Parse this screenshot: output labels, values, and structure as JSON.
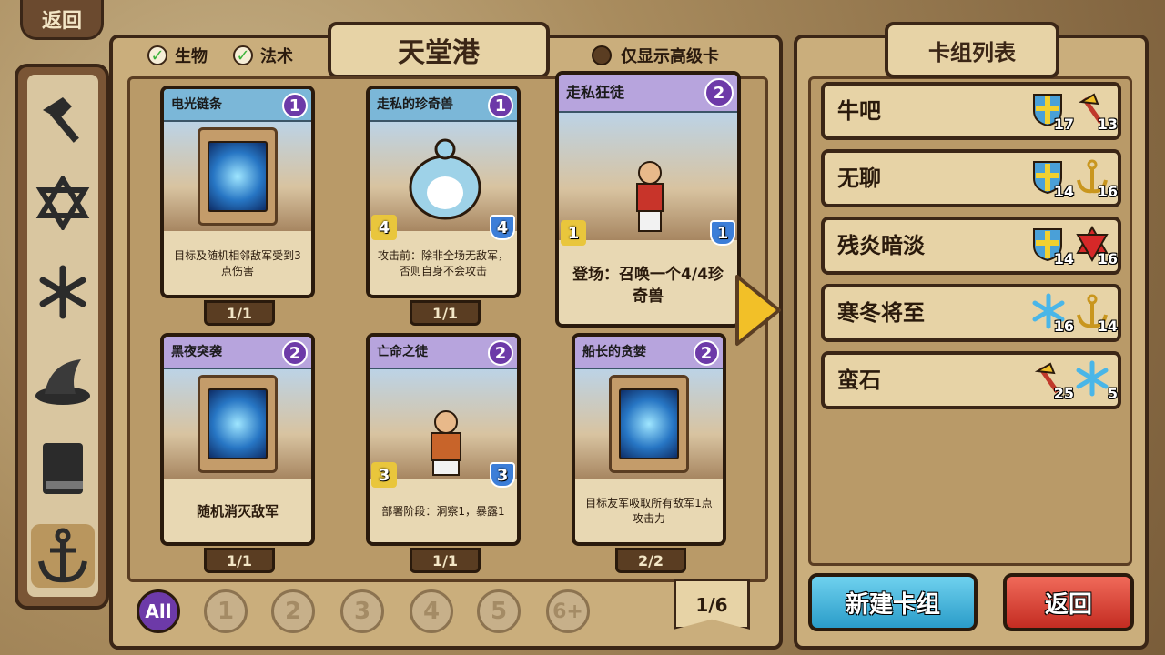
{
  "top_back_label": "返回",
  "filters": {
    "creature_label": "生物",
    "spell_label": "法术",
    "advanced_only_label": "仅显示高级卡"
  },
  "card_panel_title": "天堂港",
  "cards": [
    {
      "name": "电光链条",
      "cost": "1",
      "text": "目标及随机相邻敌军受到3点伤害",
      "count": "1/1"
    },
    {
      "name": "走私的珍奇兽",
      "cost": "1",
      "attack": "4",
      "health": "4",
      "text": "攻击前：除非全场无敌军，否则自身不会攻击",
      "count": "1/1"
    },
    {
      "name": "走私狂徒",
      "cost": "2",
      "attack": "1",
      "health": "1",
      "text": "登场：召唤一个4/4珍奇兽"
    },
    {
      "name": "黑夜突袭",
      "cost": "2",
      "text": "随机消灭敌军",
      "count": "1/1"
    },
    {
      "name": "亡命之徒",
      "cost": "2",
      "attack": "3",
      "health": "3",
      "text": "部署阶段：洞察1，暴露1",
      "count": "1/1"
    },
    {
      "name": "船长的贪婪",
      "cost": "2",
      "text": "目标友军吸取所有敌军1点攻击力",
      "count": "2/2"
    }
  ],
  "cost_filters": [
    "All",
    "1",
    "2",
    "3",
    "4",
    "5",
    "6+"
  ],
  "page_indicator": "1/6",
  "deck_panel_title": "卡组列表",
  "decks": [
    {
      "name": "牛吧",
      "stat1": "17",
      "stat2": "13",
      "icon1": "shield-icon",
      "icon2": "axe-icon"
    },
    {
      "name": "无聊",
      "stat1": "14",
      "stat2": "16",
      "icon1": "shield-icon",
      "icon2": "anchor-icon"
    },
    {
      "name": "残炎暗淡",
      "stat1": "14",
      "stat2": "16",
      "icon1": "shield-icon",
      "icon2": "red-star-icon"
    },
    {
      "name": "寒冬将至",
      "stat1": "16",
      "stat2": "14",
      "icon1": "snowflake-icon",
      "icon2": "anchor-icon"
    },
    {
      "name": "蛮石",
      "stat1": "25",
      "stat2": "5",
      "icon1": "axe-icon",
      "icon2": "snowflake-icon"
    }
  ],
  "new_deck_label": "新建卡组",
  "back_label": "返回"
}
